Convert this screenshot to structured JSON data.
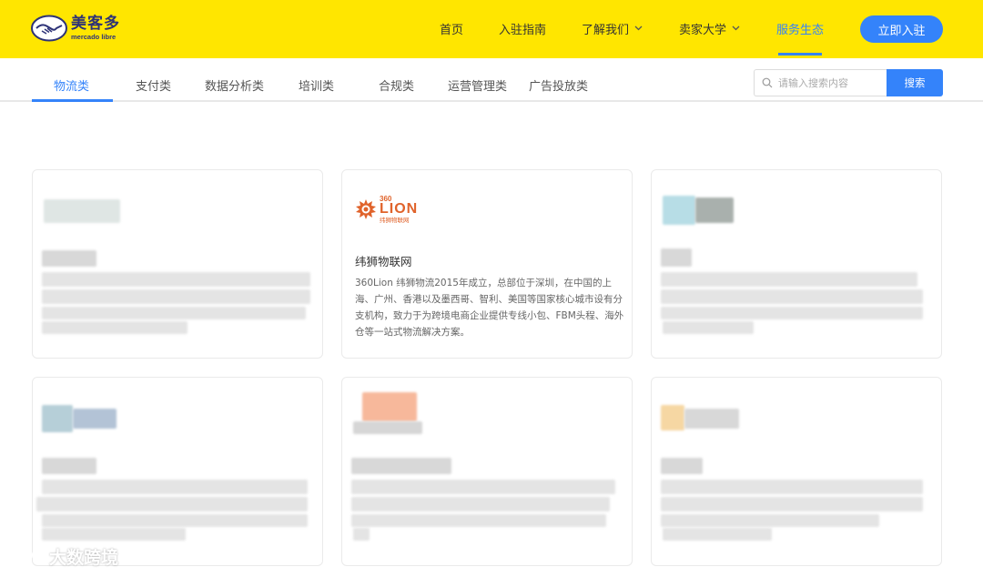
{
  "brand": {
    "name_cn": "美客多",
    "name_en": "mercado libre"
  },
  "nav": {
    "items": [
      {
        "label": "首页",
        "has_dropdown": false,
        "active": false
      },
      {
        "label": "入驻指南",
        "has_dropdown": false,
        "active": false
      },
      {
        "label": "了解我们",
        "has_dropdown": true,
        "active": false
      },
      {
        "label": "卖家大学",
        "has_dropdown": true,
        "active": false
      },
      {
        "label": "服务生态",
        "has_dropdown": false,
        "active": true
      }
    ],
    "cta_label": "立即入驻"
  },
  "categories": {
    "tabs": [
      {
        "label": "物流类",
        "active": true
      },
      {
        "label": "支付类",
        "active": false
      },
      {
        "label": "数据分析类",
        "active": false
      },
      {
        "label": "培训类",
        "active": false
      },
      {
        "label": "合规类",
        "active": false
      },
      {
        "label": "运营管理类",
        "active": false
      },
      {
        "label": "广告投放类",
        "active": false
      }
    ]
  },
  "search": {
    "placeholder": "请输入搜索内容",
    "button_label": "搜索"
  },
  "featured_card": {
    "logo_number": "360",
    "logo_word": "LION",
    "logo_caption": "纬狮物联网",
    "title": "纬狮物联网",
    "description": "360Lion 纬狮物流2015年成立，总部位于深圳，在中国的上海、广州、香港以及墨西哥、智利、美国等国家核心城市设有分支机构，致力于为跨境电商企业提供专线小包、FBM头程、海外仓等一站式物流解决方案。"
  },
  "watermark": {
    "text": "大数跨境"
  },
  "colors": {
    "header_bg": "#ffe600",
    "accent": "#3483fa",
    "brand_navy": "#2d3277",
    "lion_orange": "#e0632b"
  }
}
